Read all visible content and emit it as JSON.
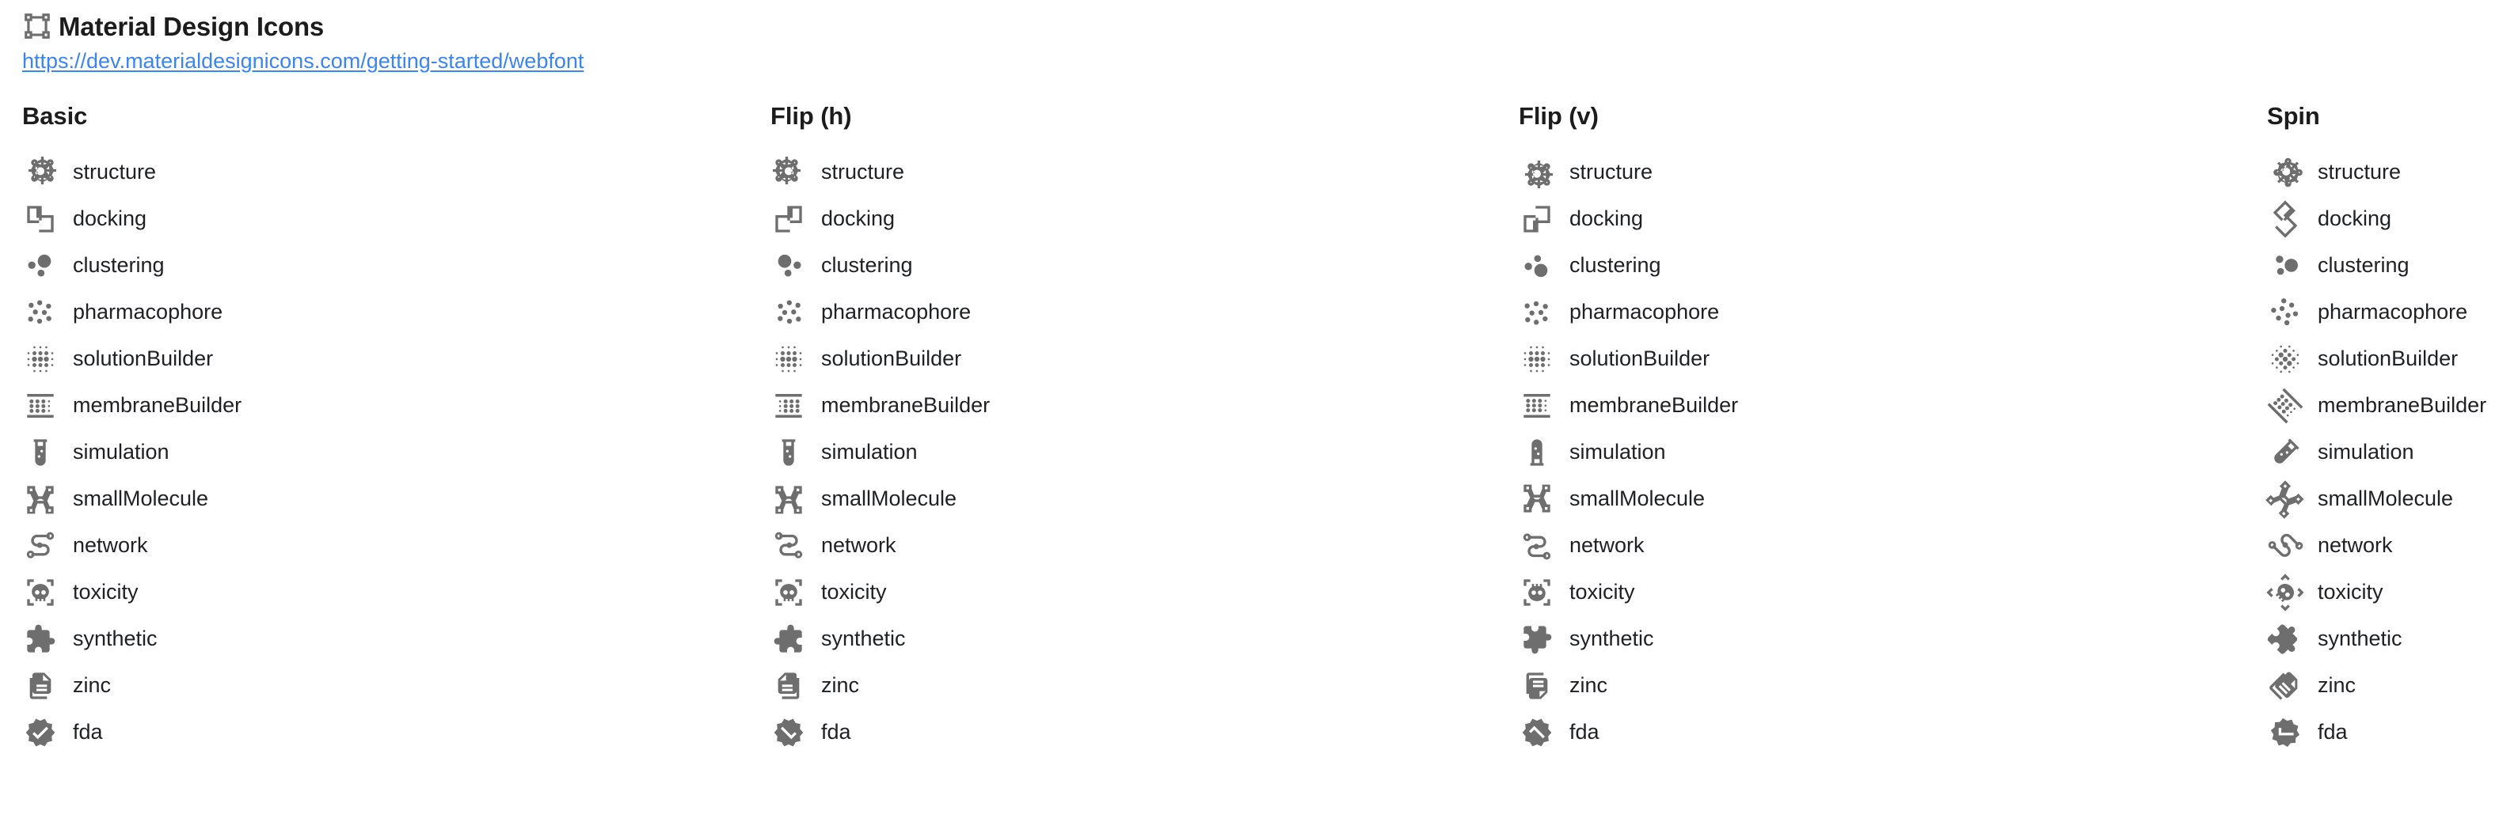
{
  "header": {
    "title": "Material Design Icons",
    "title_icon": "vector-square-icon",
    "link": "https://dev.materialdesignicons.com/getting-started/webfont"
  },
  "columns": [
    {
      "title": "Basic",
      "transform": "none"
    },
    {
      "title": "Flip (h)",
      "transform": "flip-h"
    },
    {
      "title": "Flip (v)",
      "transform": "flip-v"
    },
    {
      "title": "Spin",
      "transform": "spin"
    }
  ],
  "icons": [
    {
      "label": "structure",
      "icon": "molecule-icon"
    },
    {
      "label": "docking",
      "icon": "vector-union-icon"
    },
    {
      "label": "clustering",
      "icon": "scatter-plot-icon"
    },
    {
      "label": "pharmacophore",
      "icon": "dots-scatter-icon"
    },
    {
      "label": "solutionBuilder",
      "icon": "blur-icon"
    },
    {
      "label": "membraneBuilder",
      "icon": "layers-dots-icon"
    },
    {
      "label": "simulation",
      "icon": "test-tube-icon"
    },
    {
      "label": "smallMolecule",
      "icon": "molecule-nodes-icon"
    },
    {
      "label": "network",
      "icon": "graph-path-icon"
    },
    {
      "label": "toxicity",
      "icon": "skull-scan-icon"
    },
    {
      "label": "synthetic",
      "icon": "puzzle-icon"
    },
    {
      "label": "zinc",
      "icon": "file-document-multiple-icon"
    },
    {
      "label": "fda",
      "icon": "check-decagram-icon"
    }
  ],
  "colors": {
    "icon": "#6e6e6e",
    "text": "#202124",
    "link": "#3b85f0",
    "background": "#ffffff"
  }
}
